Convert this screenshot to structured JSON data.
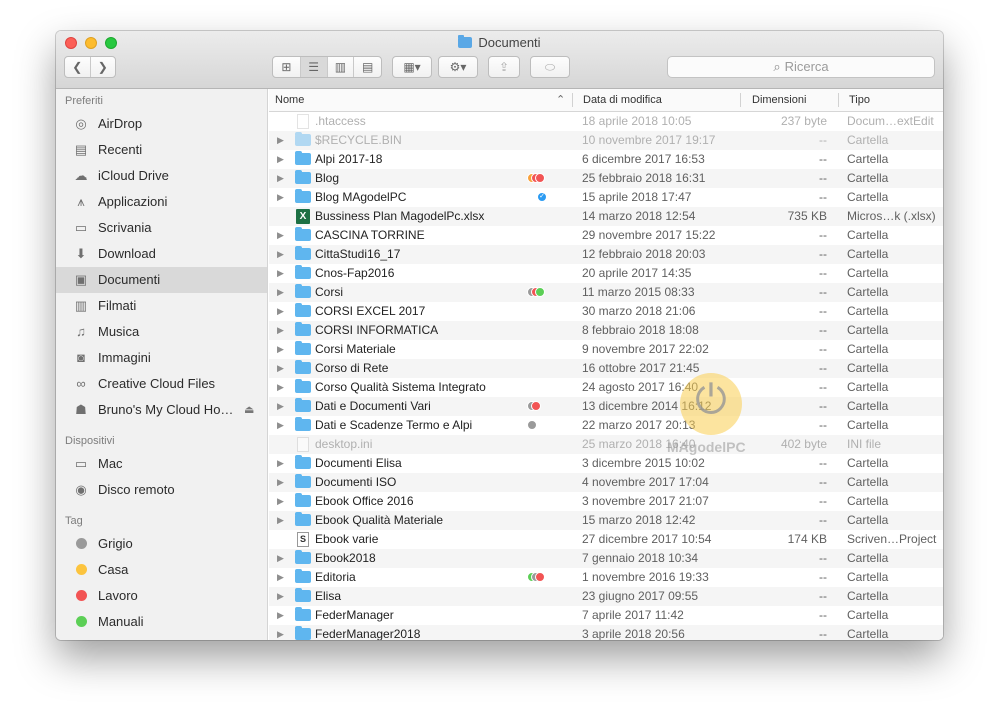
{
  "window": {
    "title": "Documenti",
    "colors": {
      "close": "#fc5f57",
      "minimize": "#fdbc2e",
      "zoom": "#28c840",
      "folder": "#5fb6ef"
    }
  },
  "toolbar": {
    "back_icon": "chevron-left-icon",
    "forward_icon": "chevron-right-icon",
    "view_icons": [
      "icon-view-icon",
      "list-view-icon",
      "column-view-icon",
      "cover-flow-icon"
    ],
    "search_placeholder": "Ricerca"
  },
  "sidebar": {
    "favorites_header": "Preferiti",
    "favorites": [
      {
        "label": "AirDrop",
        "icon": "airdrop-icon"
      },
      {
        "label": "Recenti",
        "icon": "recents-icon"
      },
      {
        "label": "iCloud Drive",
        "icon": "cloud-icon"
      },
      {
        "label": "Applicazioni",
        "icon": "applications-icon"
      },
      {
        "label": "Scrivania",
        "icon": "desktop-icon"
      },
      {
        "label": "Download",
        "icon": "download-icon"
      },
      {
        "label": "Documenti",
        "icon": "documents-icon",
        "selected": true
      },
      {
        "label": "Filmati",
        "icon": "movies-icon"
      },
      {
        "label": "Musica",
        "icon": "music-icon"
      },
      {
        "label": "Immagini",
        "icon": "pictures-icon"
      },
      {
        "label": "Creative Cloud Files",
        "icon": "creative-cloud-icon"
      },
      {
        "label": "Bruno's My Cloud Ho…",
        "icon": "network-drive-icon",
        "eject": true
      }
    ],
    "devices_header": "Dispositivi",
    "devices": [
      {
        "label": "Mac",
        "icon": "computer-icon"
      },
      {
        "label": "Disco remoto",
        "icon": "remote-disc-icon"
      }
    ],
    "tags_header": "Tag",
    "tags": [
      {
        "label": "Grigio",
        "color": "#9a9a9a"
      },
      {
        "label": "Casa",
        "color": "#fcc43e"
      },
      {
        "label": "Lavoro",
        "color": "#f25454"
      },
      {
        "label": "Manuali",
        "color": "#5ccf56"
      }
    ]
  },
  "columns": {
    "name": "Nome",
    "date": "Data di modifica",
    "size": "Dimensioni",
    "kind": "Tipo"
  },
  "files": [
    {
      "name": ".htaccess",
      "date": "18 aprile 2018 10:05",
      "size": "237 byte",
      "kind": "Docum…extEdit",
      "icon": "doc",
      "folder": false,
      "dim": true,
      "tags": []
    },
    {
      "name": "$RECYCLE.BIN",
      "date": "10 novembre 2017 19:17",
      "size": "--",
      "kind": "Cartella",
      "icon": "folder",
      "folder": true,
      "dim": true,
      "tags": []
    },
    {
      "name": "Alpi 2017-18",
      "date": "6 dicembre 2017 16:53",
      "size": "--",
      "kind": "Cartella",
      "icon": "folder",
      "folder": true,
      "dim": false,
      "tags": []
    },
    {
      "name": "Blog",
      "date": "25 febbraio 2018 16:31",
      "size": "--",
      "kind": "Cartella",
      "icon": "folder",
      "folder": true,
      "dim": false,
      "tags": [
        "#f9a13a",
        "#f25454",
        "#f25454"
      ]
    },
    {
      "name": "Blog MAgodelPC",
      "date": "15 aprile 2018 17:47",
      "size": "--",
      "kind": "Cartella",
      "icon": "folder",
      "folder": true,
      "dim": false,
      "tags": [
        "check"
      ]
    },
    {
      "name": "Bussiness Plan MagodelPc.xlsx",
      "date": "14 marzo 2018 12:54",
      "size": "735 KB",
      "kind": "Micros…k (.xlsx)",
      "icon": "xls",
      "folder": false,
      "dim": false,
      "tags": []
    },
    {
      "name": "CASCINA TORRINE",
      "date": "29 novembre 2017 15:22",
      "size": "--",
      "kind": "Cartella",
      "icon": "folder",
      "folder": true,
      "dim": false,
      "tags": []
    },
    {
      "name": "CittaStudi16_17",
      "date": "12 febbraio 2018 20:03",
      "size": "--",
      "kind": "Cartella",
      "icon": "folder",
      "folder": true,
      "dim": false,
      "tags": []
    },
    {
      "name": "Cnos-Fap2016",
      "date": "20 aprile 2017 14:35",
      "size": "--",
      "kind": "Cartella",
      "icon": "folder",
      "folder": true,
      "dim": false,
      "tags": []
    },
    {
      "name": "Corsi",
      "date": "11 marzo 2015 08:33",
      "size": "--",
      "kind": "Cartella",
      "icon": "folder",
      "folder": true,
      "dim": false,
      "tags": [
        "#9a9a9a",
        "#f25454",
        "#5ccf56"
      ]
    },
    {
      "name": "CORSI EXCEL 2017",
      "date": "30 marzo 2018 21:06",
      "size": "--",
      "kind": "Cartella",
      "icon": "folder",
      "folder": true,
      "dim": false,
      "tags": []
    },
    {
      "name": "CORSI INFORMATICA",
      "date": "8 febbraio 2018 18:08",
      "size": "--",
      "kind": "Cartella",
      "icon": "folder",
      "folder": true,
      "dim": false,
      "tags": []
    },
    {
      "name": "Corsi Materiale",
      "date": "9 novembre 2017 22:02",
      "size": "--",
      "kind": "Cartella",
      "icon": "folder",
      "folder": true,
      "dim": false,
      "tags": []
    },
    {
      "name": "Corso di Rete",
      "date": "16 ottobre 2017 21:45",
      "size": "--",
      "kind": "Cartella",
      "icon": "folder",
      "folder": true,
      "dim": false,
      "tags": []
    },
    {
      "name": "Corso Qualità Sistema Integrato",
      "date": "24 agosto 2017 16:40",
      "size": "--",
      "kind": "Cartella",
      "icon": "folder",
      "folder": true,
      "dim": false,
      "tags": []
    },
    {
      "name": "Dati e Documenti Vari",
      "date": "13 dicembre 2014 16:12",
      "size": "--",
      "kind": "Cartella",
      "icon": "folder",
      "folder": true,
      "dim": false,
      "tags": [
        "#9a9a9a",
        "#f25454"
      ]
    },
    {
      "name": "Dati e Scadenze Termo e Alpi",
      "date": "22 marzo 2017 20:13",
      "size": "--",
      "kind": "Cartella",
      "icon": "folder",
      "folder": true,
      "dim": false,
      "tags": [
        "#9a9a9a"
      ]
    },
    {
      "name": "desktop.ini",
      "date": "25 marzo 2018 16:40",
      "size": "402 byte",
      "kind": "INI file",
      "icon": "doc",
      "folder": false,
      "dim": true,
      "tags": []
    },
    {
      "name": "Documenti Elisa",
      "date": "3 dicembre 2015 10:02",
      "size": "--",
      "kind": "Cartella",
      "icon": "folder",
      "folder": true,
      "dim": false,
      "tags": []
    },
    {
      "name": "Documenti ISO",
      "date": "4 novembre 2017 17:04",
      "size": "--",
      "kind": "Cartella",
      "icon": "folder",
      "folder": true,
      "dim": false,
      "tags": []
    },
    {
      "name": "Ebook Office 2016",
      "date": "3 novembre 2017 21:07",
      "size": "--",
      "kind": "Cartella",
      "icon": "folder",
      "folder": true,
      "dim": false,
      "tags": []
    },
    {
      "name": "Ebook Qualità Materiale",
      "date": "15 marzo 2018 12:42",
      "size": "--",
      "kind": "Cartella",
      "icon": "folder",
      "folder": true,
      "dim": false,
      "tags": []
    },
    {
      "name": "Ebook varie",
      "date": "27 dicembre 2017 10:54",
      "size": "174 KB",
      "kind": "Scriven…Project",
      "icon": "scriv",
      "folder": false,
      "dim": false,
      "tags": []
    },
    {
      "name": "Ebook2018",
      "date": "7 gennaio 2018 10:34",
      "size": "--",
      "kind": "Cartella",
      "icon": "folder",
      "folder": true,
      "dim": false,
      "tags": []
    },
    {
      "name": "Editoria",
      "date": "1 novembre 2016 19:33",
      "size": "--",
      "kind": "Cartella",
      "icon": "folder",
      "folder": true,
      "dim": false,
      "tags": [
        "#5ccf56",
        "#9a9a9a",
        "#f25454"
      ]
    },
    {
      "name": "Elisa",
      "date": "23 giugno 2017 09:55",
      "size": "--",
      "kind": "Cartella",
      "icon": "folder",
      "folder": true,
      "dim": false,
      "tags": []
    },
    {
      "name": "FederManager",
      "date": "7 aprile 2017 11:42",
      "size": "--",
      "kind": "Cartella",
      "icon": "folder",
      "folder": true,
      "dim": false,
      "tags": []
    },
    {
      "name": "FederManager2018",
      "date": "3 aprile 2018 20:56",
      "size": "--",
      "kind": "Cartella",
      "icon": "folder",
      "folder": true,
      "dim": false,
      "tags": []
    }
  ],
  "watermark": {
    "text": "MAgodelPC",
    "logo_icon": "power-icon"
  }
}
